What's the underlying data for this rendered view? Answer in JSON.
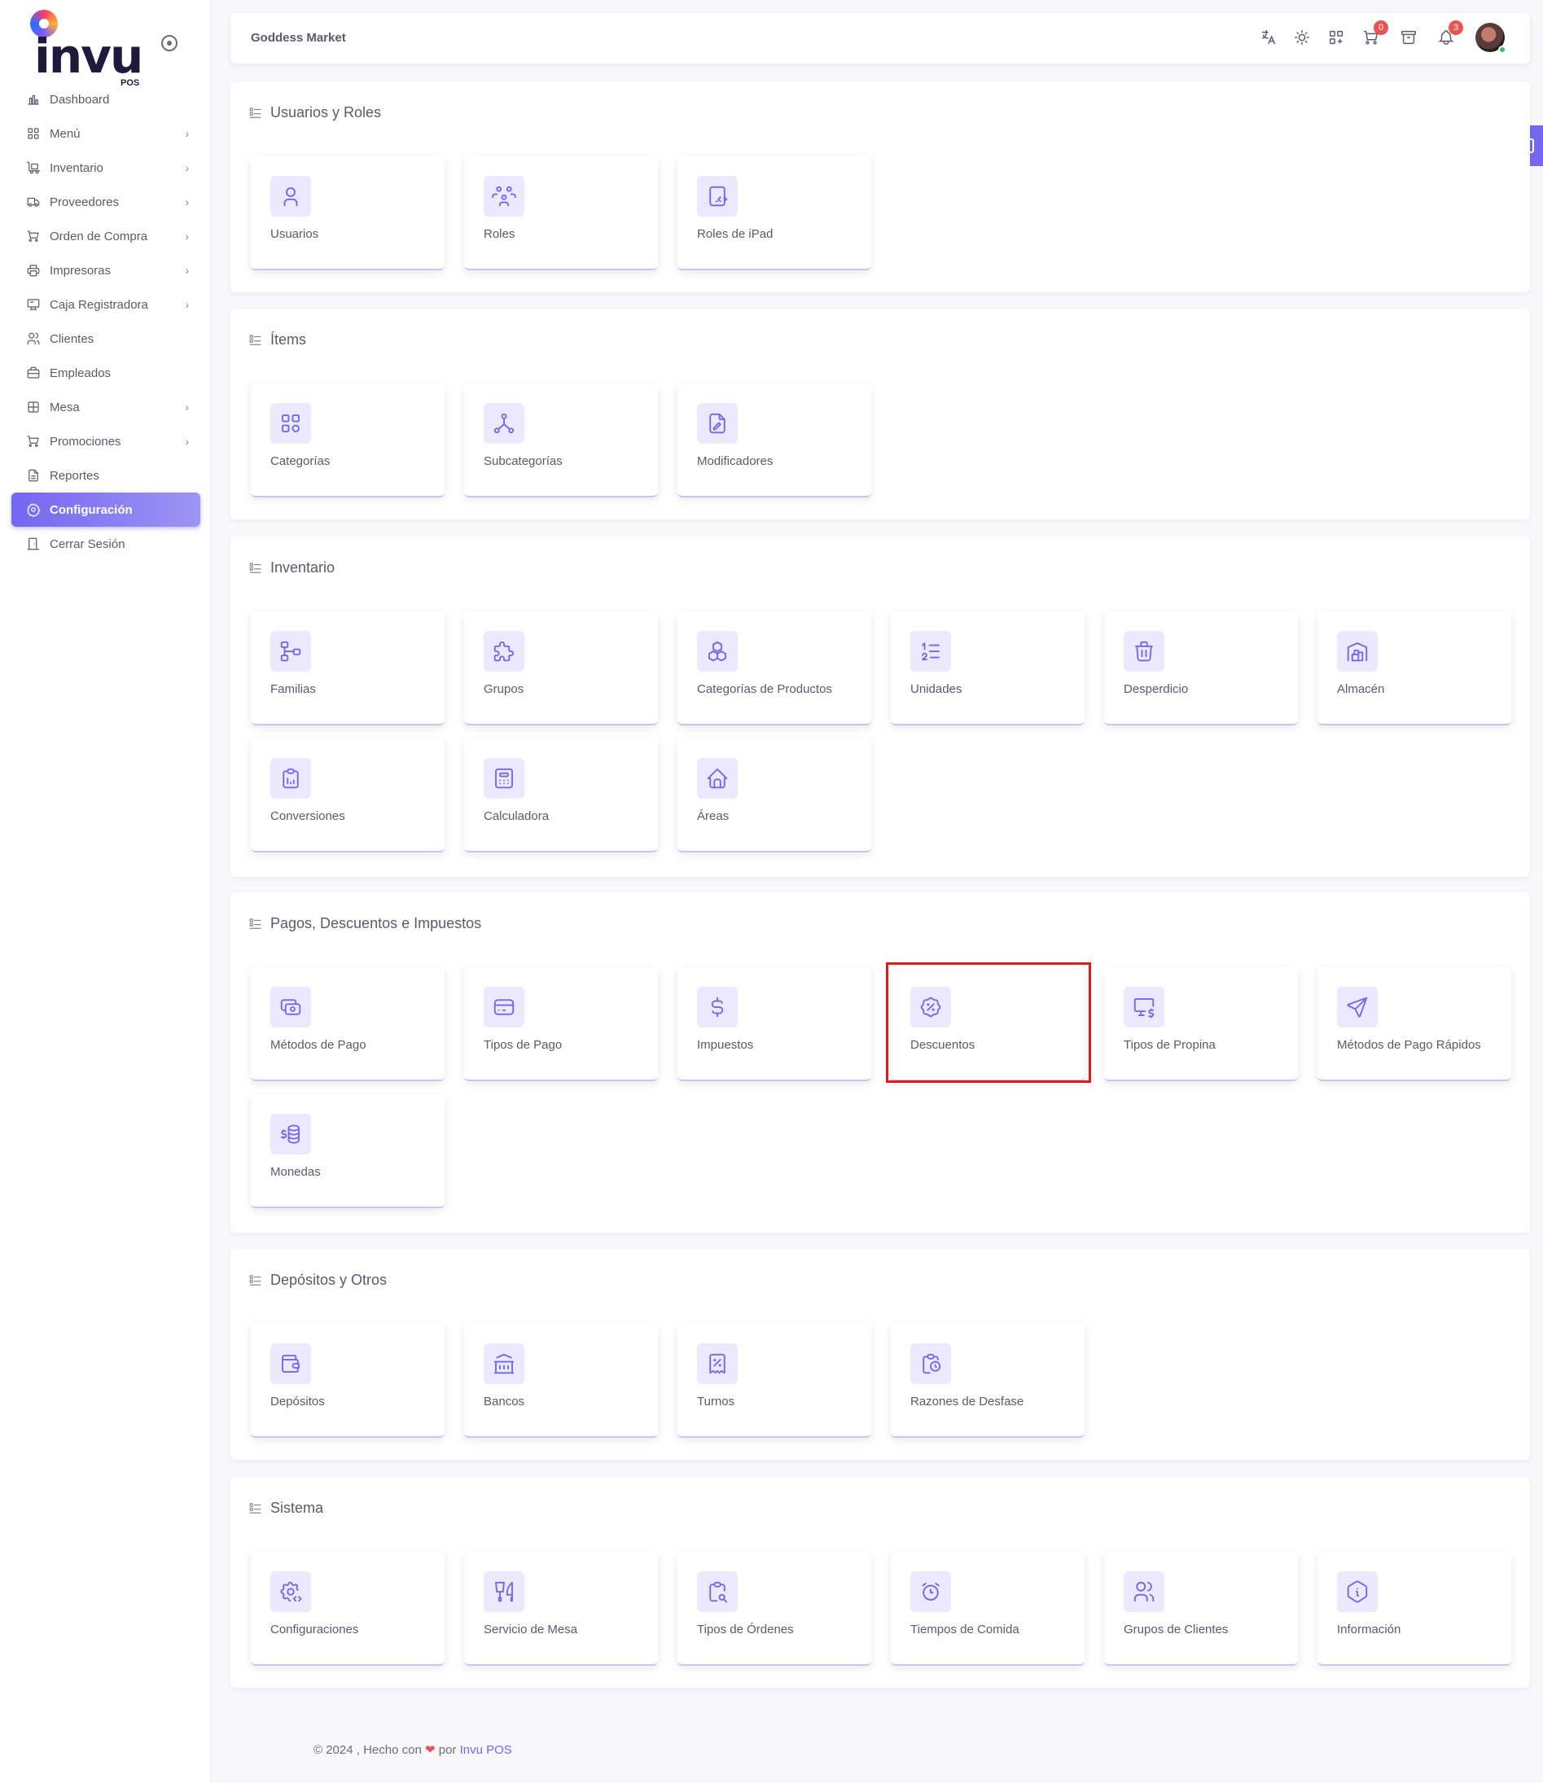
{
  "sidebar": {
    "logo": "invu",
    "logo_sub": "POS",
    "items": [
      {
        "label": "Dashboard",
        "icon": "chart-bar-icon",
        "chevron": false
      },
      {
        "label": "Menú",
        "icon": "grid-icon",
        "chevron": true
      },
      {
        "label": "Inventario",
        "icon": "truck-loading-icon",
        "chevron": true
      },
      {
        "label": "Proveedores",
        "icon": "truck-icon",
        "chevron": true
      },
      {
        "label": "Orden de Compra",
        "icon": "cart-icon",
        "chevron": true
      },
      {
        "label": "Impresoras",
        "icon": "printer-icon",
        "chevron": true
      },
      {
        "label": "Caja Registradora",
        "icon": "register-icon",
        "chevron": true
      },
      {
        "label": "Clientes",
        "icon": "users-icon",
        "chevron": false
      },
      {
        "label": "Empleados",
        "icon": "briefcase-icon",
        "chevron": false
      },
      {
        "label": "Mesa",
        "icon": "table-icon",
        "chevron": true
      },
      {
        "label": "Promociones",
        "icon": "cart-icon",
        "chevron": true
      },
      {
        "label": "Reportes",
        "icon": "report-icon",
        "chevron": false
      },
      {
        "label": "Configuración",
        "icon": "gear-icon",
        "chevron": false,
        "active": true
      },
      {
        "label": "Cerrar Sesión",
        "icon": "logout-icon",
        "chevron": false
      }
    ]
  },
  "topbar": {
    "store_name": "Goddess Market",
    "cart_badge": "0",
    "notification_badge": "3"
  },
  "sections": [
    {
      "title": "Usuarios y Roles",
      "cards": [
        {
          "label": "Usuarios",
          "icon": "user-icon"
        },
        {
          "label": "Roles",
          "icon": "users-group-icon"
        },
        {
          "label": "Roles de iPad",
          "icon": "device-tablet-code-icon"
        }
      ]
    },
    {
      "title": "Ítems",
      "cards": [
        {
          "label": "Categorías",
          "icon": "category-icon"
        },
        {
          "label": "Subcategorías",
          "icon": "hierarchy-icon"
        },
        {
          "label": "Modificadores",
          "icon": "file-edit-icon"
        }
      ]
    },
    {
      "title": "Inventario",
      "cards": [
        {
          "label": "Familias",
          "icon": "sitemap-icon"
        },
        {
          "label": "Grupos",
          "icon": "puzzle-icon"
        },
        {
          "label": "Categorías de Productos",
          "icon": "boxes-icon"
        },
        {
          "label": "Unidades",
          "icon": "list-numbers-icon"
        },
        {
          "label": "Desperdicio",
          "icon": "trash-icon"
        },
        {
          "label": "Almacén",
          "icon": "building-warehouse-icon"
        },
        {
          "label": "Conversiones",
          "icon": "clipboard-data-icon"
        },
        {
          "label": "Calculadora",
          "icon": "calculator-icon"
        },
        {
          "label": "Áreas",
          "icon": "home-icon"
        }
      ]
    },
    {
      "title": "Pagos, Descuentos e Impuestos",
      "cards": [
        {
          "label": "Métodos de Pago",
          "icon": "cash-icon"
        },
        {
          "label": "Tipos de Pago",
          "icon": "credit-card-icon"
        },
        {
          "label": "Impuestos",
          "icon": "currency-dollar-icon"
        },
        {
          "label": "Descuentos",
          "icon": "discount-icon",
          "highlighted": true
        },
        {
          "label": "Tipos de Propina",
          "icon": "device-desktop-dollar-icon"
        },
        {
          "label": "Métodos de Pago Rápidos",
          "icon": "send-icon"
        },
        {
          "label": "Monedas",
          "icon": "coins-icon"
        }
      ]
    },
    {
      "title": "Depósitos y Otros",
      "cards": [
        {
          "label": "Depósitos",
          "icon": "wallet-icon"
        },
        {
          "label": "Bancos",
          "icon": "building-bank-icon"
        },
        {
          "label": "Turnos",
          "icon": "receipt-tax-icon"
        },
        {
          "label": "Razones de Desfase",
          "icon": "clipboard-clock-icon"
        }
      ]
    },
    {
      "title": "Sistema",
      "cards": [
        {
          "label": "Configuraciones",
          "icon": "settings-code-icon"
        },
        {
          "label": "Servicio de Mesa",
          "icon": "tools-kitchen-icon"
        },
        {
          "label": "Tipos de Órdenes",
          "icon": "clipboard-search-icon"
        },
        {
          "label": "Tiempos de Comida",
          "icon": "alarm-icon"
        },
        {
          "label": "Grupos de Clientes",
          "icon": "users-icon"
        },
        {
          "label": "Información",
          "icon": "info-hexagon-icon"
        }
      ]
    }
  ],
  "footer": {
    "prefix": "© 2024 , Hecho con",
    "middle": "por",
    "brand": "Invu POS"
  },
  "colors": {
    "accent": "#7367f0",
    "icon_bg": "#ebe9fd",
    "highlight": "#e01b1b",
    "badge": "#ea5455"
  }
}
